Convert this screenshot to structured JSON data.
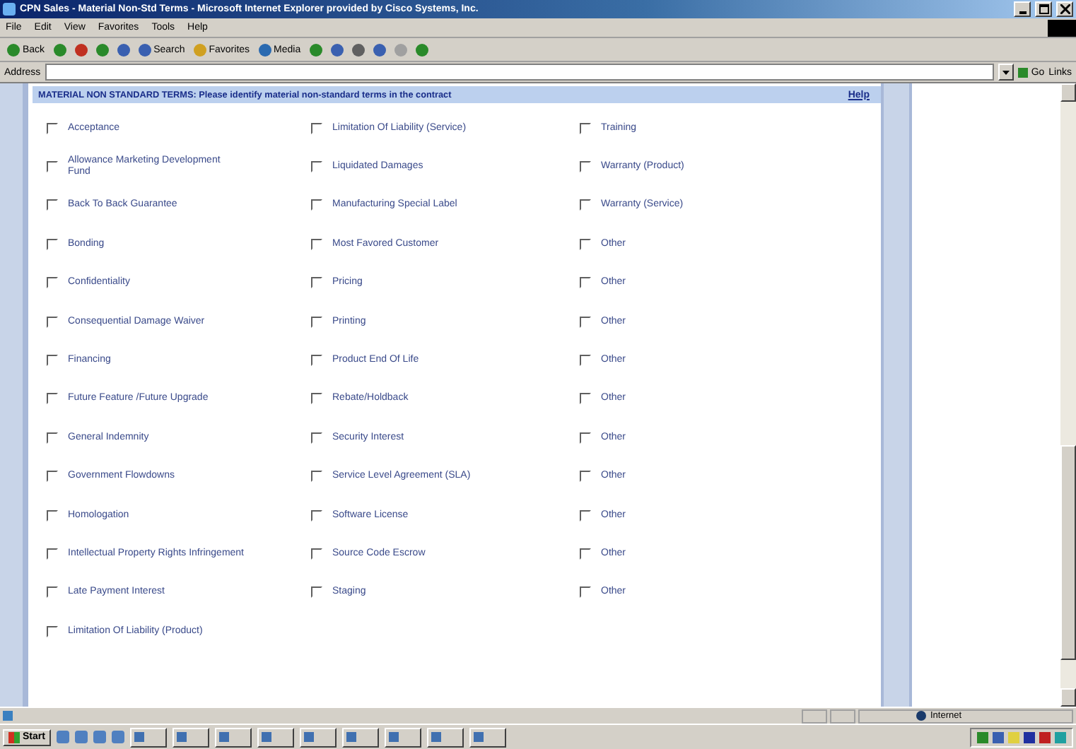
{
  "window": {
    "title": "CPN Sales - Material Non-Std Terms - Microsoft Internet Explorer provided by Cisco Systems, Inc."
  },
  "menu": [
    "File",
    "Edit",
    "View",
    "Favorites",
    "Tools",
    "Help"
  ],
  "toolbar": [
    {
      "kind": "back",
      "label": "Back"
    },
    {
      "kind": "forward"
    },
    {
      "kind": "stop"
    },
    {
      "kind": "refresh"
    },
    {
      "kind": "home"
    },
    {
      "kind": "search",
      "label": "Search"
    },
    {
      "kind": "favorites",
      "label": "Favorites"
    },
    {
      "kind": "media",
      "label": "Media"
    },
    {
      "kind": "history"
    },
    {
      "kind": "mail"
    },
    {
      "kind": "print"
    },
    {
      "kind": "edit"
    },
    {
      "kind": "discuss"
    },
    {
      "kind": "messenger"
    }
  ],
  "address": {
    "label": "Address",
    "go": "Go",
    "links": "Links"
  },
  "form": {
    "heading": "MATERIAL NON STANDARD TERMS: Please identify material non-standard terms in the contract",
    "help": "Help",
    "terms": [
      [
        {
          "label": "Acceptance",
          "checked": false
        },
        {
          "label": "Limitation Of Liability (Service)",
          "checked": false
        },
        {
          "label": "Training",
          "checked": false
        }
      ],
      [
        {
          "label": "Allowance Marketing Development Fund",
          "checked": false
        },
        {
          "label": "Liquidated Damages",
          "checked": false
        },
        {
          "label": "Warranty (Product)",
          "checked": false
        }
      ],
      [
        {
          "label": "Back To Back Guarantee",
          "checked": false
        },
        {
          "label": "Manufacturing Special Label",
          "checked": false
        },
        {
          "label": "Warranty (Service)",
          "checked": false
        }
      ],
      [
        {
          "label": "Bonding",
          "checked": false
        },
        {
          "label": "Most Favored Customer",
          "checked": false
        },
        {
          "label": "Other",
          "checked": false
        }
      ],
      [
        {
          "label": "Confidentiality",
          "checked": false
        },
        {
          "label": "Pricing",
          "checked": false
        },
        {
          "label": "Other",
          "checked": false
        }
      ],
      [
        {
          "label": "Consequential Damage Waiver",
          "checked": false
        },
        {
          "label": "Printing",
          "checked": false
        },
        {
          "label": "Other",
          "checked": false
        }
      ],
      [
        {
          "label": "Financing",
          "checked": false
        },
        {
          "label": "Product End Of Life",
          "checked": false
        },
        {
          "label": "Other",
          "checked": false
        }
      ],
      [
        {
          "label": "Future Feature /Future Upgrade",
          "checked": false
        },
        {
          "label": "Rebate/Holdback",
          "checked": false
        },
        {
          "label": "Other",
          "checked": false
        }
      ],
      [
        {
          "label": "General Indemnity",
          "checked": false
        },
        {
          "label": "Security Interest",
          "checked": false
        },
        {
          "label": "Other",
          "checked": false
        }
      ],
      [
        {
          "label": "Government Flowdowns",
          "checked": false
        },
        {
          "label": "Service Level Agreement (SLA)",
          "checked": false
        },
        {
          "label": "Other",
          "checked": false
        }
      ],
      [
        {
          "label": "Homologation",
          "checked": false
        },
        {
          "label": "Software License",
          "checked": false
        },
        {
          "label": "Other",
          "checked": false
        }
      ],
      [
        {
          "label": "Intellectual Property Rights Infringement",
          "checked": false
        },
        {
          "label": "Source Code Escrow",
          "checked": false
        },
        {
          "label": "Other",
          "checked": false
        }
      ],
      [
        {
          "label": "Late Payment Interest",
          "checked": false
        },
        {
          "label": "Staging",
          "checked": false
        },
        {
          "label": "Other",
          "checked": false
        }
      ],
      [
        {
          "label": "Limitation Of Liability (Product)",
          "checked": false
        }
      ]
    ]
  },
  "status_bar": {
    "zone": "Internet"
  },
  "taskbar": {
    "start": "Start"
  }
}
